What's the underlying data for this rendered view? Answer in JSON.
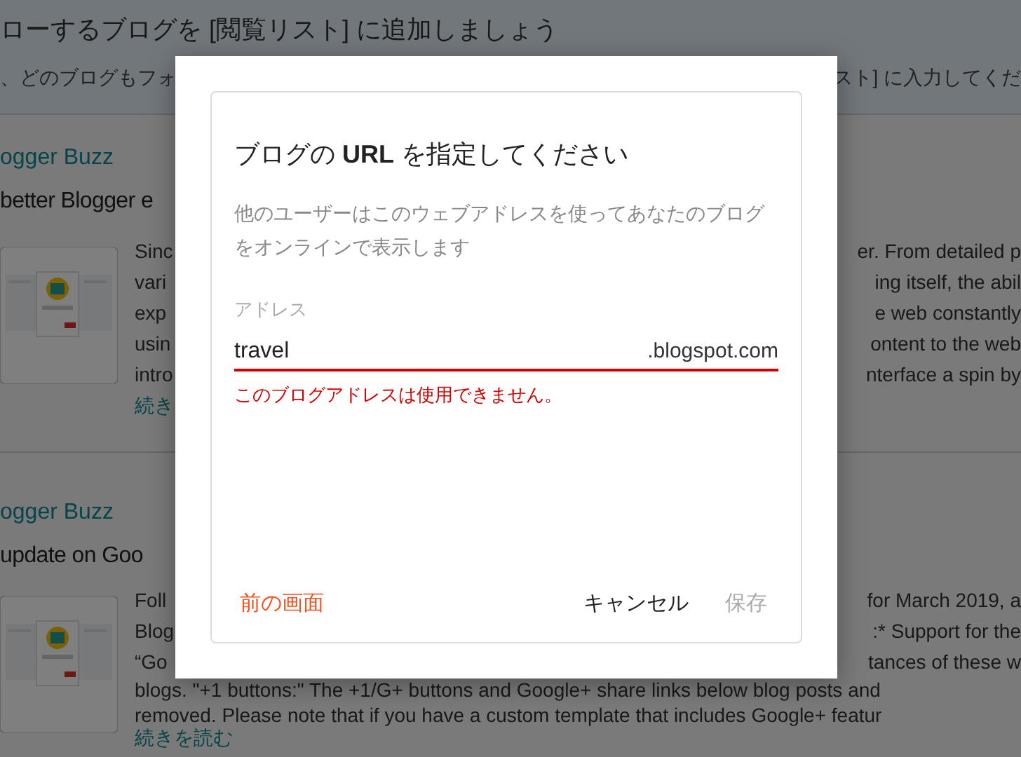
{
  "page": {
    "header": {
      "title": "ローするブログを [閲覧リスト] に追加しましょう",
      "hint_left": "、どのブログもフォ",
      "hint_right": "スト] に入力してくだ"
    },
    "posts": [
      {
        "source": "ogger Buzz",
        "title": "better Blogger e",
        "split_lines": [
          {
            "left": "Sinc",
            "right": "er. From detailed p"
          },
          {
            "left": "vari",
            "right": "ing itself, the abil"
          },
          {
            "left": "exp",
            "right": "e web constantly"
          },
          {
            "left": "usin",
            "right": "ontent to the web"
          },
          {
            "left": "intro",
            "right": "nterface a spin by"
          }
        ],
        "more": "続き"
      },
      {
        "source": "ogger Buzz",
        "title": "update on Goo",
        "split_lines": [
          {
            "left": "Foll",
            "right": "for March 2019, a"
          },
          {
            "left": "Blog",
            "right": ":* Support for the"
          },
          {
            "left": "“Go",
            "right": "tances of these w"
          }
        ],
        "full_lines": [
          "blogs. \"+1 buttons:\" The +1/G+ buttons and Google+ share links below blog posts and",
          "removed. Please note that if you have a custom template that includes Google+ featur"
        ],
        "more": "続きを読む"
      }
    ]
  },
  "dialog": {
    "title": "ブログの **URL** を指定してください",
    "description": "他のユーザーはこのウェブアドレスを使ってあなたのブログをオンラインで表示します",
    "field": {
      "label": "アドレス",
      "value": "travel",
      "suffix": ".blogspot.com",
      "error": "このブログアドレスは使用できません。"
    },
    "buttons": [
      {
        "label": "前の画面",
        "kind": "back",
        "disabled": false
      },
      {
        "label": "キャンセル",
        "kind": "cancel",
        "disabled": false
      },
      {
        "label": "保存",
        "kind": "save",
        "disabled": true
      }
    ]
  }
}
